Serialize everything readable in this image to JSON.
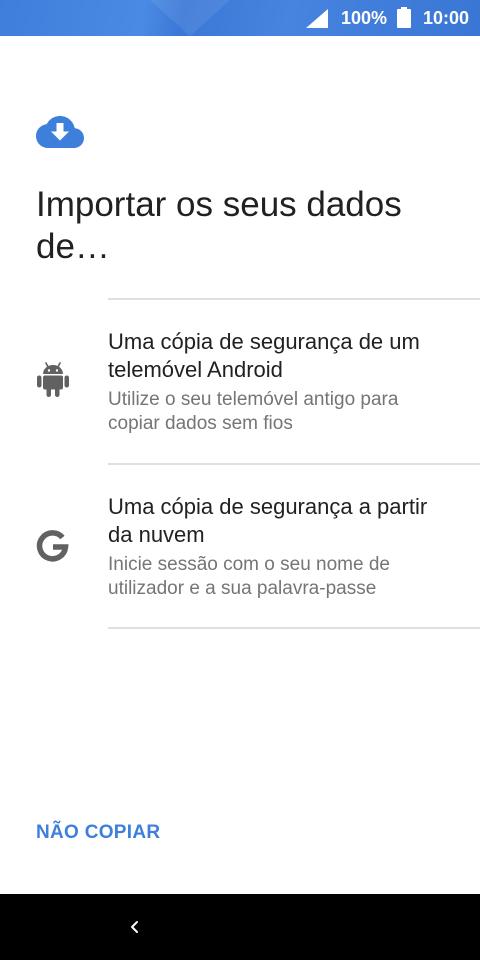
{
  "status_bar": {
    "battery_percent": "100%",
    "time": "10:00",
    "icons": [
      "signal-icon",
      "battery-icon"
    ]
  },
  "header": {
    "icon": "cloud-download-icon",
    "title": "Importar os seus dados de…"
  },
  "options": [
    {
      "icon": "android-icon",
      "title": "Uma cópia de segurança de um telemóvel Android",
      "subtitle": "Utilize o seu telemóvel antigo para copiar dados sem fios"
    },
    {
      "icon": "google-icon",
      "title": "Uma cópia de segurança a partir da nuvem",
      "subtitle": "Inicie sessão com o seu nome de utilizador e a sua palavra-passe"
    }
  ],
  "skip_button": {
    "label": "NÃO COPIAR"
  },
  "nav_bar": {
    "icons": [
      "back-icon"
    ]
  },
  "colors": {
    "accent": "#3f7fdc",
    "status_bar": "#4684e0",
    "title_text": "#212121",
    "subtitle_text": "#757575",
    "icon_gray": "#616161",
    "divider": "#e0e0e0",
    "nav_bar": "#000000"
  }
}
